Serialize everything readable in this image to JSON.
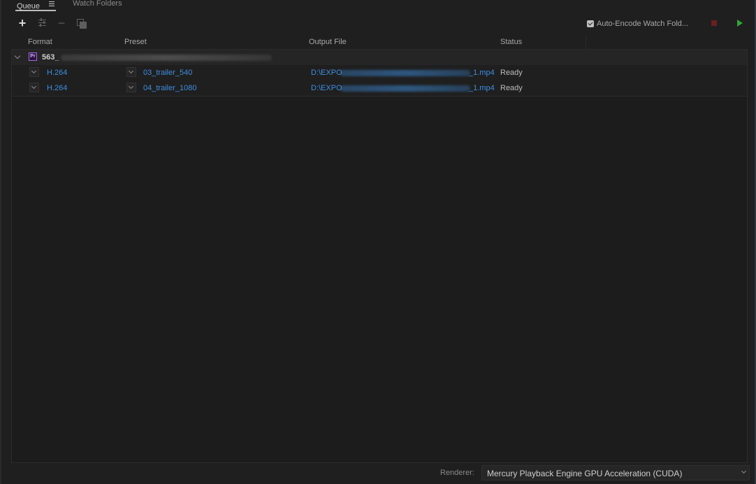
{
  "tabs": [
    {
      "label": "Queue"
    },
    {
      "label": "Watch Folders"
    }
  ],
  "toolbar": {
    "auto_encode_label": "Auto-Encode Watch Fold...",
    "auto_encode_checked": true
  },
  "columns": {
    "format": "Format",
    "preset": "Preset",
    "output": "Output File",
    "status": "Status"
  },
  "queue": {
    "group_icon": "Pr",
    "group_title": "563_",
    "items": [
      {
        "format": "H.264",
        "preset": "03_trailer_540",
        "output_prefix": "D:\\EXPO",
        "output_suffix": "_1.mp4",
        "status": "Ready"
      },
      {
        "format": "H.264",
        "preset": "04_trailer_1080",
        "output_prefix": "D:\\EXPO",
        "output_suffix": "_1.mp4",
        "status": "Ready"
      }
    ]
  },
  "footer": {
    "renderer_label": "Renderer:",
    "renderer_value": "Mercury Playback Engine GPU Acceleration (CUDA)"
  },
  "colors": {
    "link": "#3d8fe0",
    "play": "#2fa835",
    "stop": "#6b1f1f",
    "premiere_badge": "#9c6de0"
  }
}
